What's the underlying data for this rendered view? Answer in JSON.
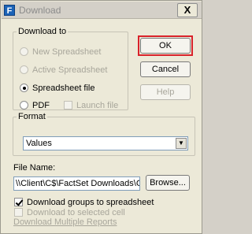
{
  "window": {
    "icon_letter": "F",
    "title": "Download",
    "close_label": "X"
  },
  "download_to": {
    "legend": "Download to",
    "options": [
      {
        "label": "New Spreadsheet",
        "selected": false,
        "enabled": false
      },
      {
        "label": "Active Spreadsheet",
        "selected": false,
        "enabled": false
      },
      {
        "label": "Spreadsheet file",
        "selected": true,
        "enabled": true
      },
      {
        "label": "PDF",
        "selected": false,
        "enabled": true
      }
    ],
    "launch_file": {
      "label": "Launch file",
      "checked": false,
      "enabled": false
    }
  },
  "buttons": {
    "ok": "OK",
    "cancel": "Cancel",
    "help": "Help",
    "browse": "Browse..."
  },
  "format": {
    "legend": "Format",
    "selected": "Values"
  },
  "file_name": {
    "label": "File Name:",
    "value": "\\\\Client\\C$\\FactSet Downloads\\GT H"
  },
  "checkboxes": [
    {
      "label": "Download groups to spreadsheet",
      "checked": true,
      "enabled": true
    },
    {
      "label": "Download to selected cell",
      "checked": false,
      "enabled": false
    }
  ],
  "link": "Download Multiple Reports",
  "colors": {
    "highlight": "#d9222a",
    "disabled_text": "#a8a69b"
  }
}
